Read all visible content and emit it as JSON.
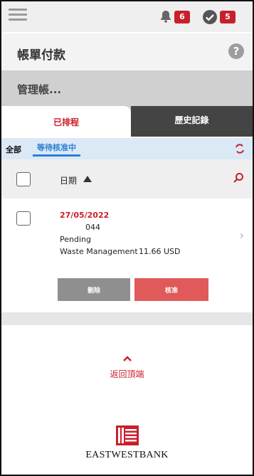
{
  "topbar": {
    "notifications_count": "6",
    "tasks_count": "5"
  },
  "header": {
    "title": "帳單付款",
    "help_label": "?"
  },
  "manage": {
    "label": "管理帳..."
  },
  "tabs": [
    {
      "label": "已排程",
      "active": true
    },
    {
      "label": "歷史記錄",
      "active": false
    }
  ],
  "filter": {
    "all_label": "全部",
    "pending_label": "等待核准中"
  },
  "list_header": {
    "sort_label": "日期"
  },
  "items": [
    {
      "date": "27/05/2022",
      "account": "044",
      "status": "Pending",
      "payee": "Waste Management",
      "amount": "11.66 USD"
    }
  ],
  "actions": {
    "delete_label": "刪除",
    "approve_label": "核准"
  },
  "back_to_top": "返回頂端",
  "brand": {
    "name": "EASTWESTBANK",
    "accent_color": "#c8202b"
  },
  "icons": [
    "hamburger-icon",
    "bell-icon",
    "check-circle-icon",
    "help-icon",
    "refresh-icon",
    "sort-up-icon",
    "search-icon",
    "chevron-right-icon",
    "caret-up-icon",
    "logo-icon"
  ]
}
